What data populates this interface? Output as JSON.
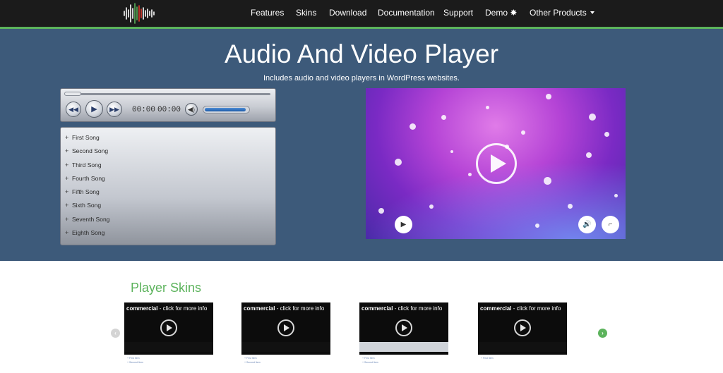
{
  "nav": {
    "items": [
      "Features",
      "Skins",
      "Download",
      "Documentation",
      "Support",
      "Demo",
      "Other Products"
    ],
    "demo_icon": "gear-icon"
  },
  "hero": {
    "title": "Audio And Video Player",
    "subtitle": "Includes audio and video players in WordPress websites."
  },
  "audio_player": {
    "current_time": "00:00",
    "total_time": "00:00",
    "volume_level": 0.95,
    "playlist": [
      "First Song",
      "Second Song",
      "Third Song",
      "Fourth Song",
      "Fifth Song",
      "Sixth Song",
      "Seventh Song",
      "Eighth Song"
    ]
  },
  "skins": {
    "title": "Player Skins",
    "thumbnails": [
      {
        "caption_bold": "commercial",
        "caption_rest": " - click for more info",
        "list": [
          "First Item",
          "Second Item"
        ]
      },
      {
        "caption_bold": "commercial",
        "caption_rest": " - click for more info",
        "list": [
          "First Item",
          "Second Item"
        ]
      },
      {
        "caption_bold": "commercial",
        "caption_rest": " - click for more info",
        "list": [
          "First Item",
          "Second Item"
        ]
      },
      {
        "caption_bold": "commercial",
        "caption_rest": " - click for more info",
        "list": [
          "First Item"
        ]
      }
    ]
  },
  "colors": {
    "accent": "#5cb35c",
    "hero_bg": "#3d5a7a",
    "navbar_bg": "#1b1b1b"
  }
}
